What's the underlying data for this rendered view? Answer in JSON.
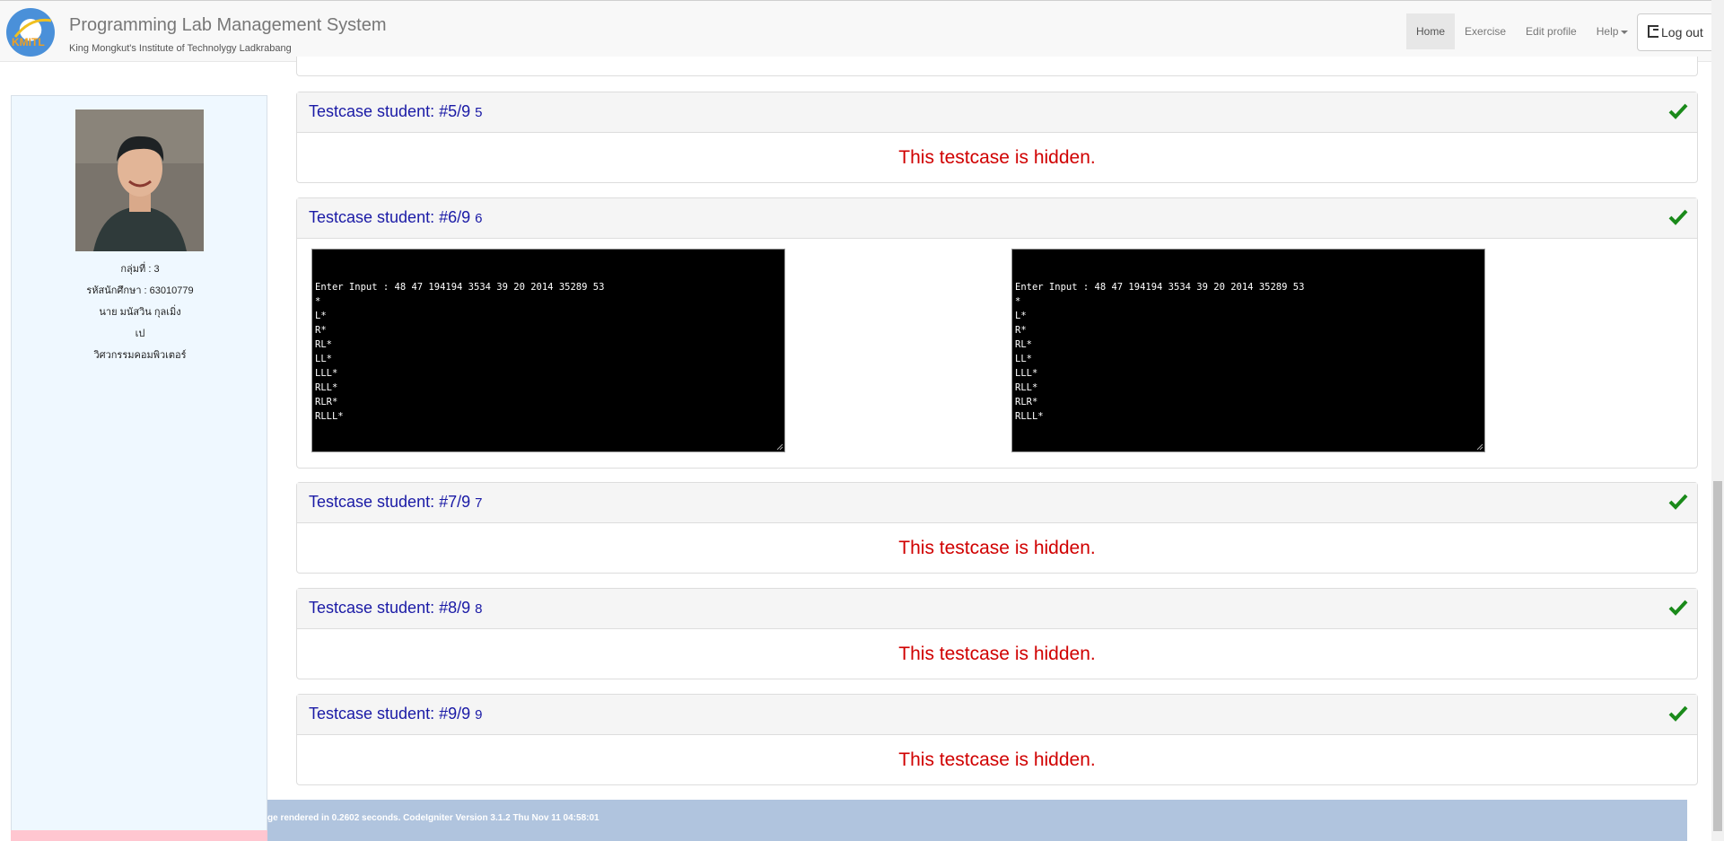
{
  "header": {
    "title": "Programming Lab Management System",
    "subtitle": "King Mongkut's Institute of Technolygy Ladkrabang",
    "logo_text": "KMITL",
    "nav": [
      {
        "label": "Home"
      },
      {
        "label": "Exercise"
      },
      {
        "label": "Edit profile"
      },
      {
        "label": "Help"
      }
    ],
    "logout_label": "Log out"
  },
  "sidebar": {
    "group": "กลุ่มที่ : 3",
    "student_id": "รหัสนักศึกษา : 63010779",
    "name": "นาย มนัสวิน กุลเมิ่ง",
    "nickname": "เป",
    "department": "วิศวกรรมคอมพิวเตอร์"
  },
  "testcases": [
    {
      "title": "Testcase student: #5/9",
      "num": "5",
      "hidden_msg": "This testcase is hidden."
    },
    {
      "title": "Testcase student: #6/9",
      "num": "6"
    },
    {
      "title": "Testcase student: #7/9",
      "num": "7",
      "hidden_msg": "This testcase is hidden."
    },
    {
      "title": "Testcase student: #8/9",
      "num": "8",
      "hidden_msg": "This testcase is hidden."
    },
    {
      "title": "Testcase student: #9/9",
      "num": "9",
      "hidden_msg": "This testcase is hidden."
    }
  ],
  "terminal_left": [
    "Enter Input : 48 47 194194 3534 39 20 2014 35289 53",
    "*",
    "L*",
    "R*",
    "RL*",
    "LL*",
    "LLL*",
    "RLL*",
    "RLR*",
    "RLLL*"
  ],
  "terminal_right": [
    "Enter Input : 48 47 194194 3534 39 20 2014 35289 53",
    "*",
    "L*",
    "R*",
    "RL*",
    "LL*",
    "LLL*",
    "RLL*",
    "RLR*",
    "RLLL*"
  ],
  "footer": {
    "text": "ge rendered in 0.2602 seconds. CodeIgniter Version 3.1.2 Thu Nov 11 04:58:01"
  },
  "colors": {
    "title_blue": "#1a1aa6",
    "hidden_red": "#d00000",
    "check_green": "#1a8a1a",
    "sidebar_bg": "#eff8ff",
    "footer_bg": "#b0c4de"
  }
}
